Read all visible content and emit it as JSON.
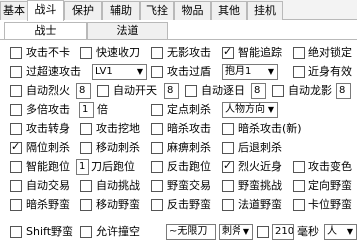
{
  "tabs": [
    "基本",
    "战斗",
    "保护",
    "辅助",
    "飞拴",
    "物品",
    "其他",
    "挂机"
  ],
  "subtabs": [
    "战士",
    "法道"
  ],
  "rows": {
    "r1": [
      "攻击不卡",
      "快速收刀",
      "无影攻击",
      "智能追踪",
      "绝对锁定"
    ],
    "r2": {
      "a": "过超速攻击",
      "a_val": "LV1",
      "b": "攻击过盾",
      "b_val": "抱月1",
      "c": "近身有效"
    },
    "r3": {
      "a": "自动烈火",
      "a_val": "8",
      "b": "自动开天",
      "b_val": "8",
      "c": "自动逐日",
      "c_val": "8",
      "d": "自动龙影",
      "d_val": "8"
    },
    "r4": {
      "a": "多倍攻击",
      "a_val": "1",
      "a_unit": "倍",
      "b": "定点刺杀",
      "b_val": "人物方向"
    },
    "r5": [
      "攻击转身",
      "攻击挖地",
      "暗杀攻击",
      "暗杀攻击(新)"
    ],
    "r6": [
      "隔位刺杀",
      "移动刺杀",
      "麻痹刺杀",
      "后退刺杀"
    ],
    "r7": {
      "a": "智能跑位",
      "a_val": "1",
      "a_unit": "刀后跑位",
      "b": "反击跑位",
      "c": "烈火近身",
      "d": "攻击变色"
    },
    "r8": [
      "自动交易",
      "自动挑战",
      "野蛮交易",
      "野蛮挑战",
      "定向野蛮"
    ],
    "r9": [
      "暗杀野蛮",
      "移动野蛮",
      "反击野蛮",
      "法道野蛮",
      "卡位野蛮"
    ],
    "r10": {
      "a": "Shift野蛮",
      "b": "允许撞空",
      "b_val": "~无限刀",
      "c_val": "刺斧",
      "d_val": "210",
      "d_unit": "毫秒",
      "e_val": "人"
    }
  },
  "checked": {
    "r1_4": true,
    "r6_1": true,
    "r7_4": true
  }
}
